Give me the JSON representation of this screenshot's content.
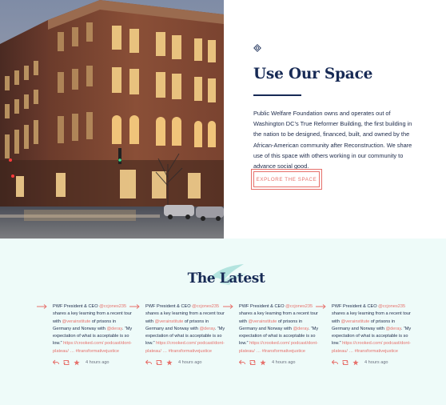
{
  "feature": {
    "title": "Use Our Space",
    "body": "Public Welfare Foundation owns and operates out of Washington DC’s True Reformer Building, the first building in the nation to be designed, financed, built, and owned by the African-American community after Reconstruction. We share use of this space with others working in our community to advance social good.",
    "cta": "EXPLORE THE SPACE"
  },
  "latest": {
    "title": "The Latest",
    "tweets": [
      {
        "lead": "PWF President & CEO ",
        "handle1": "@ccjones235",
        "mid1": " shares a key learning from a recent tour with ",
        "handle2": "@verainstitute",
        "mid2": " of prisons in Germany and Norway with ",
        "handle3": "@deray",
        "mid3": ". “My expectation of what is acceptable is so low.” ",
        "link": "https://crooked.com/ podcast/dont-plateau/ …",
        "space": " ",
        "hashtag": "#transformativejustice",
        "time": "4 hours ago"
      },
      {
        "lead": "PWF President & CEO ",
        "handle1": "@ccjones235",
        "mid1": " shares a key learning from a recent tour with ",
        "handle2": "@verainstitute",
        "mid2": " of prisons in Germany and Norway with ",
        "handle3": "@deray",
        "mid3": ". “My expectation of what is acceptable is so low.” ",
        "link": "https://crooked.com/ podcast/dont-plateau/ …",
        "space": " ",
        "hashtag": "#transformativejustice",
        "time": "4 hours ago"
      },
      {
        "lead": "PWF President & CEO ",
        "handle1": "@ccjones235",
        "mid1": " shares a key learning from a recent tour with ",
        "handle2": "@verainstitute",
        "mid2": " of prisons in Germany and Norway with ",
        "handle3": "@deray",
        "mid3": ". “My expectation of what is acceptable is so low.” ",
        "link": "https://crooked.com/ podcast/dont-plateau/ …",
        "space": " ",
        "hashtag": "#transformativejustice",
        "time": "4 hours ago"
      },
      {
        "lead": "PWF President & CEO ",
        "handle1": "@ccjones235",
        "mid1": " shares a key learning from a recent tour with ",
        "handle2": "@verainstitute",
        "mid2": " of prisons in Germany and Norway with ",
        "handle3": "@deray",
        "mid3": ". “My expectation of what is acceptable is so low.” ",
        "link": "https://crooked.com/ podcast/dont-plateau/ …",
        "space": " ",
        "hashtag": "#transformativejustice",
        "time": "4 hours ago"
      }
    ]
  },
  "colors": {
    "navy": "#172a55",
    "coral": "#e6706b",
    "mint_background": "#eefbf9",
    "ribbon_teal": "#9fdcd6"
  },
  "icons": {
    "space_mark": "diamond-badge-icon",
    "tweet_arrow": "arrow-right-icon",
    "tweet_actions": [
      "reply-icon",
      "retweet-icon",
      "like-star-icon"
    ]
  }
}
